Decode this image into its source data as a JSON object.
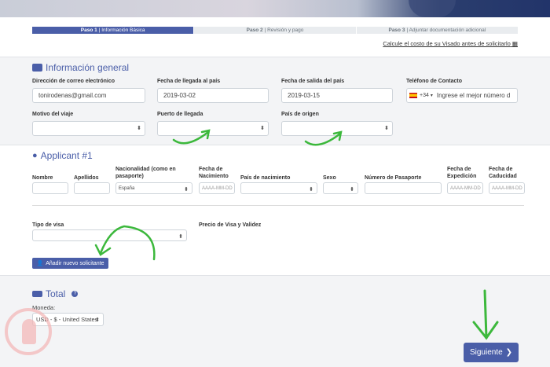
{
  "steps": [
    {
      "num": "Paso 1",
      "label": "| Información Básica"
    },
    {
      "num": "Paso 2",
      "label": "| Revisión y pago"
    },
    {
      "num": "Paso 3",
      "label": "| Adjuntar documentación adicional"
    }
  ],
  "calc_link": "Calcule el costo de su Visado antes de solicitarlo",
  "general": {
    "title": "Información general",
    "email_label": "Dirección de correo electrónico",
    "email_value": "tonirodenas@gmail.com",
    "arrival_label": "Fecha de llegada al país",
    "arrival_value": "2019-03-02",
    "departure_label": "Fecha de salida del país",
    "departure_value": "2019-03-15",
    "phone_label": "Teléfono de Contacto",
    "phone_code": "+34",
    "phone_placeholder": "Ingrese el mejor número d",
    "reason_label": "Motivo del viaje",
    "port_label": "Puerto de llegada",
    "origin_label": "País de origen"
  },
  "applicant": {
    "title": "Applicant #1",
    "name_label": "Nombre",
    "surname_label": "Apellidos",
    "nationality_label": "Nacionalidad (como en pasaporte)",
    "nationality_value": "España",
    "birthdate_label": "Fecha de Nacimiento",
    "date_placeholder": "AAAA-MM-DD",
    "birthcountry_label": "País de nacimiento",
    "sex_label": "Sexo",
    "passport_label": "Número de Pasaporte",
    "issue_label": "Fecha de Expedición",
    "expiry_label": "Fecha de Caducidad",
    "visa_type_label": "Tipo de visa",
    "price_label": "Precio de Visa y Validez",
    "add_button": "Añadir nuevo solicitante"
  },
  "total": {
    "title": "Total",
    "help": "?",
    "currency_label": "Moneda:",
    "currency_value": "USD - $ - United States"
  },
  "next_button": "Siguiente",
  "colors": {
    "accent": "#4a5ea8",
    "annotation": "#3cb83c"
  }
}
